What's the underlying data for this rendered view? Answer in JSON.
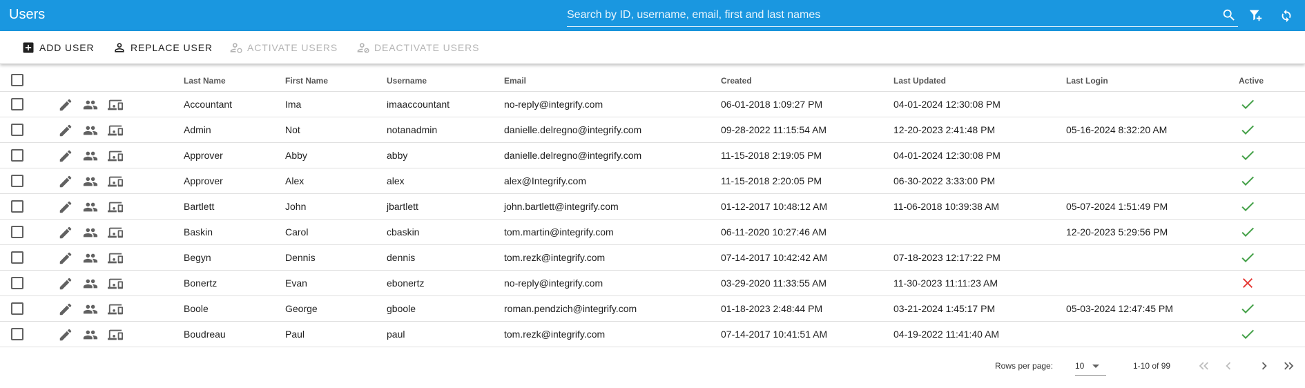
{
  "header": {
    "title": "Users",
    "search_placeholder": "Search by ID, username, email, first and last names"
  },
  "toolbar": {
    "add_user": "ADD USER",
    "replace_user": "REPLACE USER",
    "activate_users": "ACTIVATE USERS",
    "deactivate_users": "DEACTIVATE USERS"
  },
  "table": {
    "columns": {
      "last_name": "Last Name",
      "first_name": "First Name",
      "username": "Username",
      "email": "Email",
      "created": "Created",
      "last_updated": "Last Updated",
      "last_login": "Last Login",
      "active": "Active"
    },
    "rows": [
      {
        "last_name": "Accountant",
        "first_name": "Ima",
        "username": "imaaccountant",
        "email": "no-reply@integrify.com",
        "created": "06-01-2018 1:09:27 PM",
        "last_updated": "04-01-2024 12:30:08 PM",
        "last_login": "",
        "active": true
      },
      {
        "last_name": "Admin",
        "first_name": "Not",
        "username": "notanadmin",
        "email": "danielle.delregno@integrify.com",
        "created": "09-28-2022 11:15:54 AM",
        "last_updated": "12-20-2023 2:41:48 PM",
        "last_login": "05-16-2024 8:32:20 AM",
        "active": true
      },
      {
        "last_name": "Approver",
        "first_name": "Abby",
        "username": "abby",
        "email": "danielle.delregno@integrify.com",
        "created": "11-15-2018 2:19:05 PM",
        "last_updated": "04-01-2024 12:30:08 PM",
        "last_login": "",
        "active": true
      },
      {
        "last_name": "Approver",
        "first_name": "Alex",
        "username": "alex",
        "email": "alex@Integrify.com",
        "created": "11-15-2018 2:20:05 PM",
        "last_updated": "06-30-2022 3:33:00 PM",
        "last_login": "",
        "active": true
      },
      {
        "last_name": "Bartlett",
        "first_name": "John",
        "username": "jbartlett",
        "email": "john.bartlett@integrify.com",
        "created": "01-12-2017 10:48:12 AM",
        "last_updated": "11-06-2018 10:39:38 AM",
        "last_login": "05-07-2024 1:51:49 PM",
        "active": true
      },
      {
        "last_name": "Baskin",
        "first_name": "Carol",
        "username": "cbaskin",
        "email": "tom.martin@integrify.com",
        "created": "06-11-2020 10:27:46 AM",
        "last_updated": "",
        "last_login": "12-20-2023 5:29:56 PM",
        "active": true
      },
      {
        "last_name": "Begyn",
        "first_name": "Dennis",
        "username": "dennis",
        "email": "tom.rezk@integrify.com",
        "created": "07-14-2017 10:42:42 AM",
        "last_updated": "07-18-2023 12:17:22 PM",
        "last_login": "",
        "active": true
      },
      {
        "last_name": "Bonertz",
        "first_name": "Evan",
        "username": "ebonertz",
        "email": "no-reply@integrify.com",
        "created": "03-29-2020 11:33:55 AM",
        "last_updated": "11-30-2023 11:11:23 AM",
        "last_login": "",
        "active": false
      },
      {
        "last_name": "Boole",
        "first_name": "George",
        "username": "gboole",
        "email": "roman.pendzich@integrify.com",
        "created": "01-18-2023 2:48:44 PM",
        "last_updated": "03-21-2024 1:45:17 PM",
        "last_login": "05-03-2024 12:47:45 PM",
        "active": true
      },
      {
        "last_name": "Boudreau",
        "first_name": "Paul",
        "username": "paul",
        "email": "tom.rezk@integrify.com",
        "created": "07-14-2017 10:41:51 AM",
        "last_updated": "04-19-2022 11:41:40 AM",
        "last_login": "",
        "active": true
      }
    ]
  },
  "pagination": {
    "rows_per_page_label": "Rows per page:",
    "rows_per_page_value": "10",
    "range_label": "1-10 of 99"
  },
  "colors": {
    "header_bg": "#1a97e0",
    "active_check": "#43a047",
    "inactive_x": "#e53935"
  }
}
